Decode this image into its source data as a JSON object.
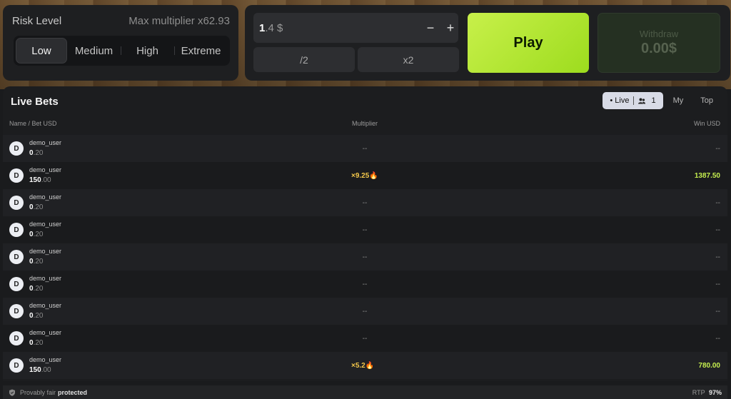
{
  "risk": {
    "title": "Risk Level",
    "max_multiplier": "Max multiplier x62.93",
    "tabs": [
      "Low",
      "Medium",
      "High",
      "Extreme"
    ],
    "selected": "Low"
  },
  "bet": {
    "amount_int": "1",
    "amount_rest": ".4 $",
    "minus": "−",
    "plus": "+",
    "half_label": "/2",
    "double_label": "x2",
    "play_label": "Play",
    "withdraw_label": "Withdraw",
    "withdraw_amount": "0.00$"
  },
  "live_bets": {
    "title": "Live Bets",
    "filters": {
      "live_label": "Live",
      "live_count": "1",
      "my_label": "My",
      "top_label": "Top"
    },
    "headers": {
      "name": "Name / Bet USD",
      "multiplier": "Multiplier",
      "win": "Win USD"
    },
    "rows": [
      {
        "avatar": "D",
        "user": "demo_user",
        "bet_int": "0",
        "bet_dec": ".20",
        "multiplier": "--",
        "win": "--",
        "hit": false
      },
      {
        "avatar": "D",
        "user": "demo_user",
        "bet_int": "150",
        "bet_dec": ".00",
        "multiplier": "×9.25🔥",
        "win": "1387.50",
        "hit": true
      },
      {
        "avatar": "D",
        "user": "demo_user",
        "bet_int": "0",
        "bet_dec": ".20",
        "multiplier": "--",
        "win": "--",
        "hit": false
      },
      {
        "avatar": "D",
        "user": "demo_user",
        "bet_int": "0",
        "bet_dec": ".20",
        "multiplier": "--",
        "win": "--",
        "hit": false
      },
      {
        "avatar": "D",
        "user": "demo_user",
        "bet_int": "0",
        "bet_dec": ".20",
        "multiplier": "--",
        "win": "--",
        "hit": false
      },
      {
        "avatar": "D",
        "user": "demo_user",
        "bet_int": "0",
        "bet_dec": ".20",
        "multiplier": "--",
        "win": "--",
        "hit": false
      },
      {
        "avatar": "D",
        "user": "demo_user",
        "bet_int": "0",
        "bet_dec": ".20",
        "multiplier": "--",
        "win": "--",
        "hit": false
      },
      {
        "avatar": "D",
        "user": "demo_user",
        "bet_int": "0",
        "bet_dec": ".20",
        "multiplier": "--",
        "win": "--",
        "hit": false
      },
      {
        "avatar": "D",
        "user": "demo_user",
        "bet_int": "150",
        "bet_dec": ".00",
        "multiplier": "×5.2🔥",
        "win": "780.00",
        "hit": true
      }
    ]
  },
  "footer": {
    "provably_fair": "Provably fair",
    "protected": "protected",
    "rtp_label": "RTP",
    "rtp_value": "97%"
  },
  "colors": {
    "play_accent": "#b6e838",
    "win_green": "#c5ee4f",
    "multiplier_gold": "#f2c64a"
  }
}
